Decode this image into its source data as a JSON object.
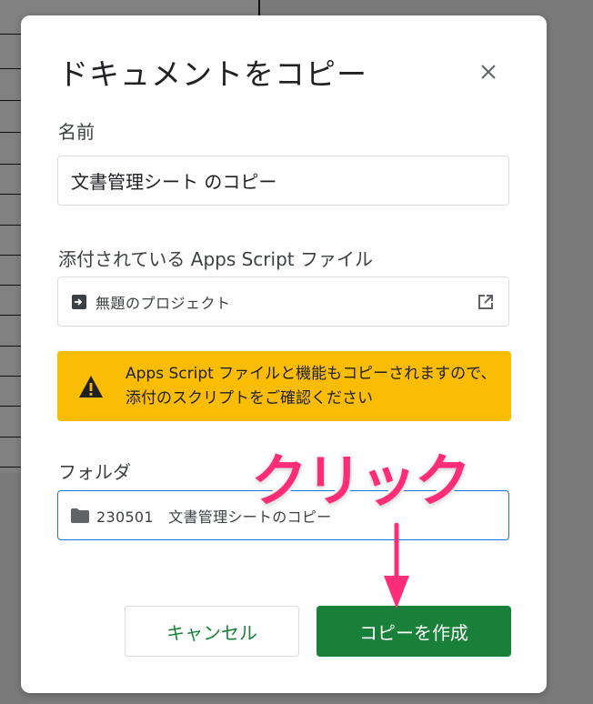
{
  "dialog": {
    "title": "ドキュメントをコピー",
    "name_label": "名前",
    "name_value": "文書管理シート のコピー",
    "script_label": "添付されている Apps Script ファイル",
    "script_name": "無題のプロジェクト",
    "warning_text": "Apps Script ファイルと機能もコピーされますので、添付のスクリプトをご確認ください",
    "folder_label": "フォルダ",
    "folder_name": "230501　文書管理シートのコピー",
    "cancel_label": "キャンセル",
    "create_label": "コピーを作成"
  },
  "annotation": {
    "text": "クリック",
    "color": "#ff2d78"
  },
  "icons": {
    "close": "close-icon",
    "script": "apps-script-icon",
    "open": "open-in-new-icon",
    "warning": "warning-icon",
    "folder": "folder-icon"
  },
  "colors": {
    "accent_green": "#188038",
    "warning_bg": "#fbbc04",
    "focus_blue": "#1a73e8"
  }
}
